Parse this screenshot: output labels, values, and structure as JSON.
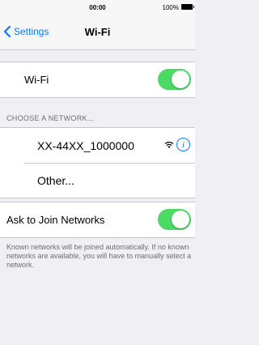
{
  "status_bar": {
    "time": "00:00",
    "battery_text": "100%",
    "battery_icon": "battery-full-icon"
  },
  "nav": {
    "back_label": "Settings",
    "back_icon": "chevron-left-icon",
    "title": "Wi-Fi"
  },
  "wifi_row": {
    "label": "Wi-Fi",
    "toggle_on": true
  },
  "networks_section": {
    "header": "CHOOSE A NETWORK...",
    "networks": [
      {
        "name": "XX-44XX_1000000",
        "signal_icon": "wifi-signal-icon",
        "info_icon": "info-icon"
      }
    ],
    "other_label": "Other..."
  },
  "ask_to_join": {
    "label": "Ask to Join Networks",
    "toggle_on": true,
    "note": "Known networks will be joined automatically. If no known networks are available, you will have to manually select a network."
  },
  "colors": {
    "accent": "#007aff",
    "toggle_on": "#4cd964",
    "background": "#efeff4",
    "section_text": "#6d6d72"
  }
}
